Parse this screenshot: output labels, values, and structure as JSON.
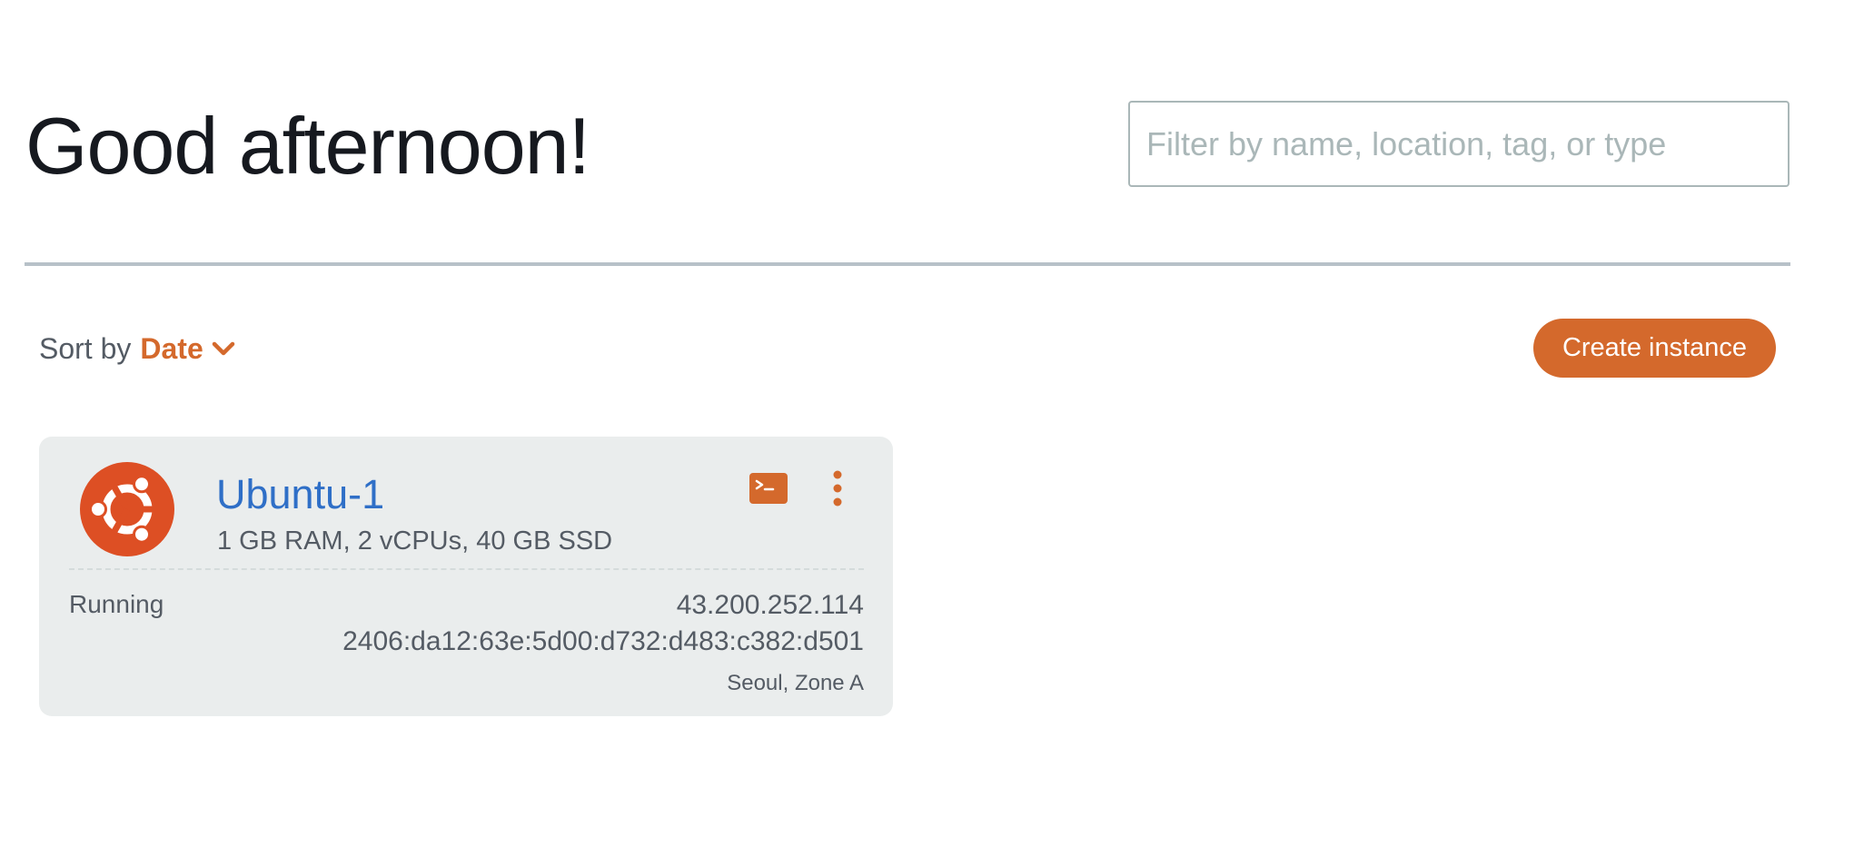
{
  "header": {
    "greeting": "Good afternoon!",
    "filter_placeholder": "Filter by name, location, tag, or type"
  },
  "toolbar": {
    "sort_label": "Sort by",
    "sort_value": "Date",
    "create_button_label": "Create instance"
  },
  "instances": [
    {
      "name": "Ubuntu-1",
      "specs": "1 GB RAM, 2 vCPUs, 40 GB SSD",
      "status": "Running",
      "public_ipv4": "43.200.252.114",
      "ipv6": "2406:da12:63e:5d00:d732:d483:c382:d501",
      "location": "Seoul, Zone A",
      "os_icon": "ubuntu-logo-icon"
    }
  ],
  "colors": {
    "accent": "#d4692c",
    "link": "#2f6fc7",
    "ubuntu": "#dd4f24",
    "card_bg": "#eaeded",
    "text_muted": "#545b64"
  }
}
